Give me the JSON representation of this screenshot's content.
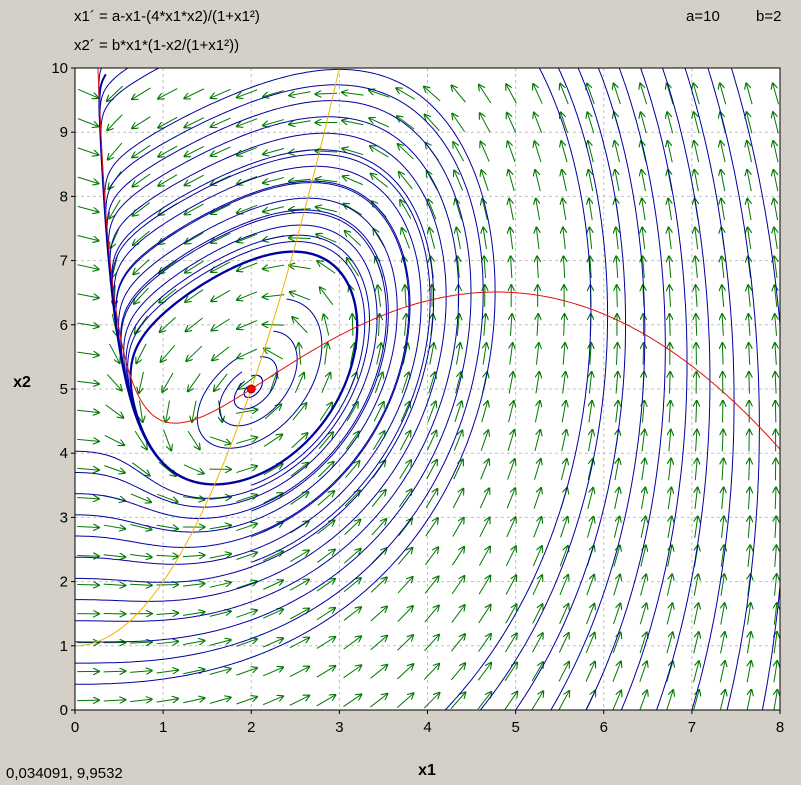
{
  "header": {
    "equation_1": "x1´ = a-x1-(4*x1*x2)/(1+x1²)",
    "equation_2": "x2´ = b*x1*(1-x2/(1+x1²))",
    "param_a": "a=10",
    "param_b": "b=2"
  },
  "status": {
    "cursor_readout": "0,034091,  9,9532"
  },
  "chart_data": {
    "type": "phase-portrait",
    "xlabel": "x1",
    "ylabel": "x2",
    "xlim": [
      0,
      8
    ],
    "ylim": [
      0,
      10
    ],
    "x_ticks": [
      "0",
      "1",
      "2",
      "3",
      "4",
      "5",
      "6",
      "7",
      "8"
    ],
    "y_ticks": [
      "0",
      "1",
      "2",
      "3",
      "4",
      "5",
      "6",
      "7",
      "8",
      "9",
      "10"
    ],
    "grid": true,
    "parameters": {
      "a": 10,
      "b": 2
    },
    "equilibrium": {
      "x1": 2,
      "x2": 5
    },
    "nullclines": [
      {
        "equation": "x2 = (a - x1)(1 + x1²) / (4 x1)",
        "color": "#e01010"
      },
      {
        "equation": "x2 = 1 + x1²",
        "color": "#f0b400"
      }
    ],
    "colors": {
      "trajectory": "#0000a0",
      "vector_field": "#007800",
      "background": "#ffffff"
    }
  }
}
